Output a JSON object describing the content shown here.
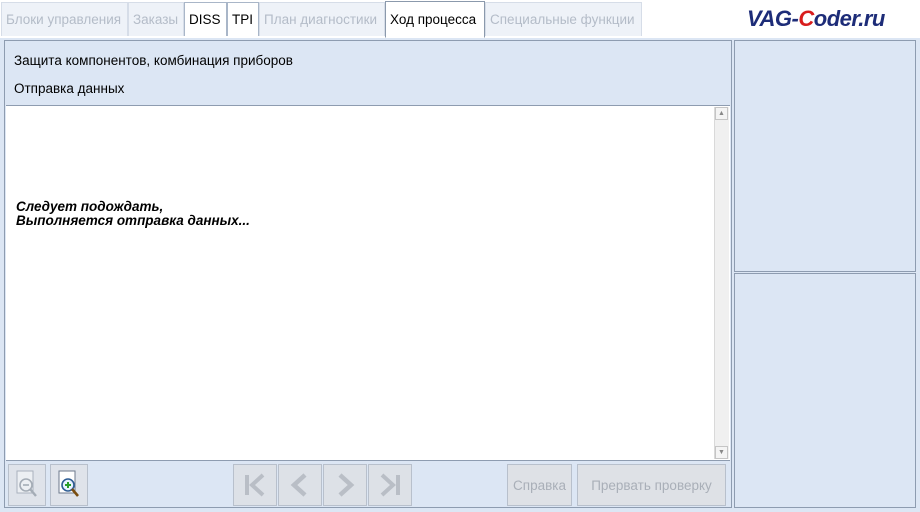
{
  "tabs": [
    {
      "label": "Блоки управления",
      "state": "disabled"
    },
    {
      "label": "Заказы",
      "state": "disabled"
    },
    {
      "label": "DISS",
      "state": "enabled"
    },
    {
      "label": "TPI",
      "state": "enabled"
    },
    {
      "label": "План диагностики",
      "state": "disabled"
    },
    {
      "label": "Ход процесса",
      "state": "active"
    },
    {
      "label": "Специальные функции",
      "state": "disabled"
    }
  ],
  "watermark": {
    "part1": "VAG-",
    "part2": "C",
    "part3": "oder.ru"
  },
  "header": {
    "title": "Защита компонентов, комбинация приборов",
    "subtitle": "Отправка данных"
  },
  "message": {
    "line1": "Следует подождать,",
    "line2": "Выполняется отправка данных..."
  },
  "toolbar": {
    "zoom_out_icon": "zoom-out-icon",
    "zoom_in_icon": "zoom-in-icon",
    "help_label": "Справка",
    "abort_label": "Прервать проверку"
  },
  "colors": {
    "panel_bg": "#dce6f4",
    "border": "#8e9cb0",
    "logo_blue": "#1d2c78",
    "logo_red": "#d81d1d",
    "disabled_text": "#a9afb8"
  }
}
